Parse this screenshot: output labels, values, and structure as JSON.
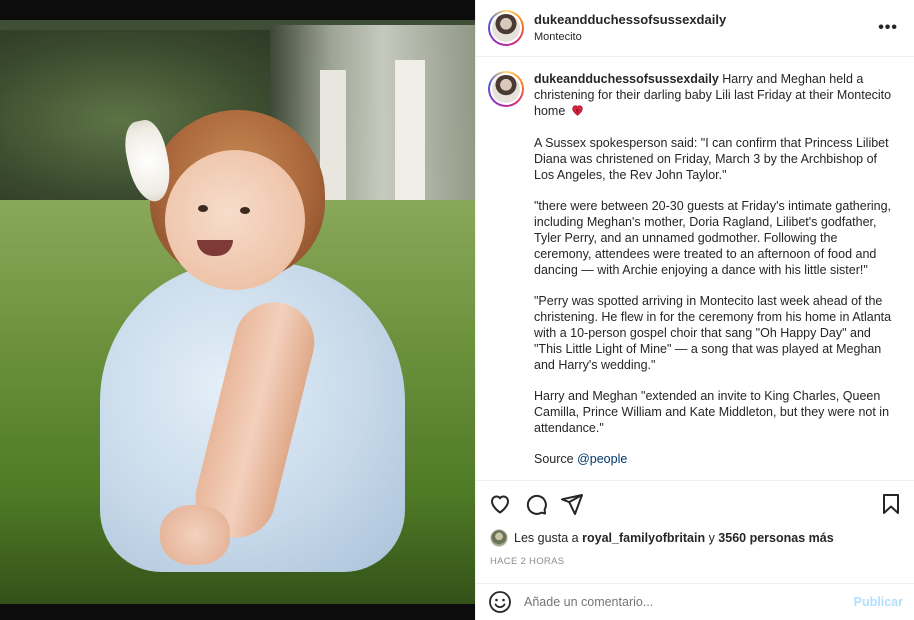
{
  "post": {
    "username": "dukeandduchessofsussexdaily",
    "location": "Montecito",
    "more_label": "•••"
  },
  "caption": {
    "username": "dukeandduchessofsussexdaily",
    "intro": "Harry and Meghan held a christening for their darling baby Lili last Friday at their Montecito home",
    "paragraphs": [
      "A Sussex spokesperson said: \"I can confirm that Princess Lilibet Diana was christened on Friday, March 3 by the Archbishop of Los Angeles, the Rev John Taylor.\"",
      "\"there were between 20-30 guests at Friday's intimate gathering, including Meghan's mother, Doria Ragland, Lilibet's godfather, Tyler Perry, and an unnamed godmother. Following the ceremony, attendees were treated to an afternoon of food and dancing — with Archie enjoying a dance with his little sister!\"",
      "\"Perry was spotted arriving in Montecito last week ahead of the christening. He flew in for the ceremony from his home in Atlanta with a 10-person gospel choir that sang \"Oh Happy Day\" and \"This Little Light of Mine\" — a song that was played at Meghan and Harry's wedding.\"",
      "Harry and Meghan \"extended an invite to King Charles, Queen Camilla, Prince William and Kate Middleton, but they were not in attendance.\""
    ],
    "source_label": "Source",
    "source_mention": "@people"
  },
  "likes": {
    "prefix": "Les gusta a",
    "user": "royal_familyofbritain",
    "joiner": "y",
    "count_text": "3560 personas más"
  },
  "timestamp": "HACE 2 HORAS",
  "comment_box": {
    "placeholder": "Añade un comentario...",
    "publish_label": "Publicar"
  },
  "icons": {
    "like": "heart-icon",
    "comment": "comment-icon",
    "share": "share-icon",
    "save": "bookmark-icon",
    "emoji": "emoji-icon",
    "caption_emoji": "red-heart-emoji"
  },
  "colors": {
    "link": "#00376b",
    "publish_disabled": "#b2dffc",
    "muted": "#8e8e8e"
  }
}
